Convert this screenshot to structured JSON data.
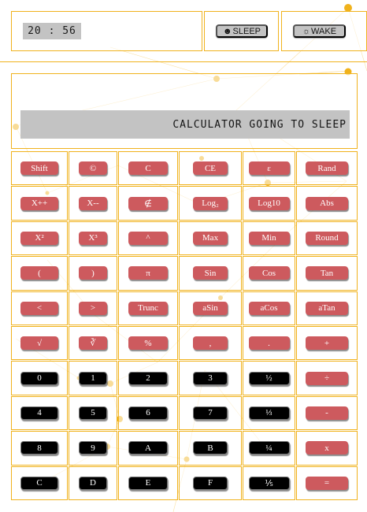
{
  "header": {
    "clock": "20 : 56",
    "sleep_icon": "moon-icon",
    "sleep_symbol": "☻",
    "sleep_label": "SLEEP",
    "wake_icon": "sun-icon",
    "wake_symbol": "☼",
    "wake_label": "WAKE"
  },
  "display": {
    "text": "CALCULATOR GOING TO SLEEP"
  },
  "colors": {
    "accent": "#f0b21c",
    "button_red": "#cd5a5e",
    "button_black": "#000000",
    "screen_gray": "#c3c3c3"
  },
  "keypad": [
    [
      {
        "label": "Shift",
        "style": "red"
      },
      {
        "label": "©",
        "style": "red"
      },
      {
        "label": "C",
        "style": "red"
      },
      {
        "label": "CE",
        "style": "red"
      },
      {
        "label": "ε",
        "style": "red"
      },
      {
        "label": "Rand",
        "style": "red"
      }
    ],
    [
      {
        "label": "X++",
        "style": "red"
      },
      {
        "label": "X--",
        "style": "red"
      },
      {
        "label": "∉",
        "style": "red"
      },
      {
        "label": "Log₂",
        "style": "red"
      },
      {
        "label": "Log10",
        "style": "red"
      },
      {
        "label": "Abs",
        "style": "red"
      }
    ],
    [
      {
        "label": "X²",
        "style": "red"
      },
      {
        "label": "X³",
        "style": "red"
      },
      {
        "label": "^",
        "style": "red"
      },
      {
        "label": "Max",
        "style": "red"
      },
      {
        "label": "Min",
        "style": "red"
      },
      {
        "label": "Round",
        "style": "red"
      }
    ],
    [
      {
        "label": "(",
        "style": "red"
      },
      {
        "label": ")",
        "style": "red"
      },
      {
        "label": "π",
        "style": "red"
      },
      {
        "label": "Sin",
        "style": "red"
      },
      {
        "label": "Cos",
        "style": "red"
      },
      {
        "label": "Tan",
        "style": "red"
      }
    ],
    [
      {
        "label": "<",
        "style": "red"
      },
      {
        "label": ">",
        "style": "red"
      },
      {
        "label": "Trunc",
        "style": "red"
      },
      {
        "label": "aSin",
        "style": "red"
      },
      {
        "label": "aCos",
        "style": "red"
      },
      {
        "label": "aTan",
        "style": "red"
      }
    ],
    [
      {
        "label": "√",
        "style": "red"
      },
      {
        "label": "∛",
        "style": "red"
      },
      {
        "label": "%",
        "style": "red"
      },
      {
        "label": ",",
        "style": "red"
      },
      {
        "label": ".",
        "style": "red"
      },
      {
        "label": "+",
        "style": "red"
      }
    ],
    [
      {
        "label": "0",
        "style": "black"
      },
      {
        "label": "1",
        "style": "black"
      },
      {
        "label": "2",
        "style": "black"
      },
      {
        "label": "3",
        "style": "black"
      },
      {
        "label": "½",
        "style": "black"
      },
      {
        "label": "÷",
        "style": "red"
      }
    ],
    [
      {
        "label": "4",
        "style": "black"
      },
      {
        "label": "5",
        "style": "black"
      },
      {
        "label": "6",
        "style": "black"
      },
      {
        "label": "7",
        "style": "black"
      },
      {
        "label": "⅓",
        "style": "black"
      },
      {
        "label": "-",
        "style": "red"
      }
    ],
    [
      {
        "label": "8",
        "style": "black"
      },
      {
        "label": "9",
        "style": "black"
      },
      {
        "label": "A",
        "style": "black"
      },
      {
        "label": "B",
        "style": "black"
      },
      {
        "label": "¼",
        "style": "black"
      },
      {
        "label": "x",
        "style": "red"
      }
    ],
    [
      {
        "label": "C",
        "style": "black"
      },
      {
        "label": "D",
        "style": "black"
      },
      {
        "label": "E",
        "style": "black"
      },
      {
        "label": "F",
        "style": "black"
      },
      {
        "label": "⅕",
        "style": "black"
      },
      {
        "label": "=",
        "style": "red"
      }
    ]
  ]
}
